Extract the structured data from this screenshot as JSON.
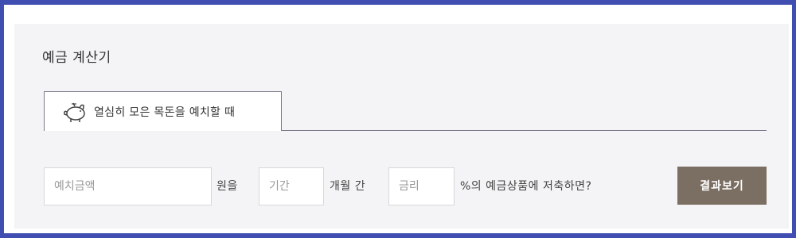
{
  "calculator": {
    "title": "예금 계산기",
    "tab_label": "열심히 모은 목돈을 예치할 때",
    "amount_placeholder": "예치금액",
    "amount_unit": "원을",
    "period_placeholder": "기간",
    "period_unit": "개월 간",
    "rate_placeholder": "금리",
    "rate_suffix": "%의 예금상품에 저축하면?",
    "submit_label": "결과보기"
  },
  "colors": {
    "outer_border": "#3f4eb0",
    "panel_bg": "#f4f3f5",
    "tab_border": "#7f7a8c",
    "button_bg": "#7b6e62"
  },
  "icons": {
    "tab_icon": "piggy-bank-icon"
  }
}
